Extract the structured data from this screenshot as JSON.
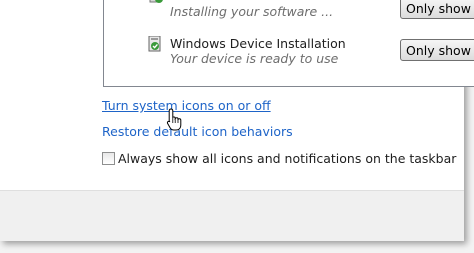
{
  "notification_list": {
    "rows": [
      {
        "title": "",
        "status": "Installing your software ...",
        "behavior": "Only show"
      },
      {
        "title": "Windows Device Installation",
        "status": "Your device is ready to use",
        "behavior": "Only show"
      }
    ]
  },
  "links": {
    "system_icons": "Turn system icons on or off",
    "restore_defaults": "Restore default icon behaviors"
  },
  "always_show": {
    "label": "Always show all icons and notifications on the taskbar",
    "checked": false
  },
  "colors": {
    "link": "#1e64c8",
    "status_text": "#6d6d6d",
    "icon_green": "#3a9a3a"
  }
}
